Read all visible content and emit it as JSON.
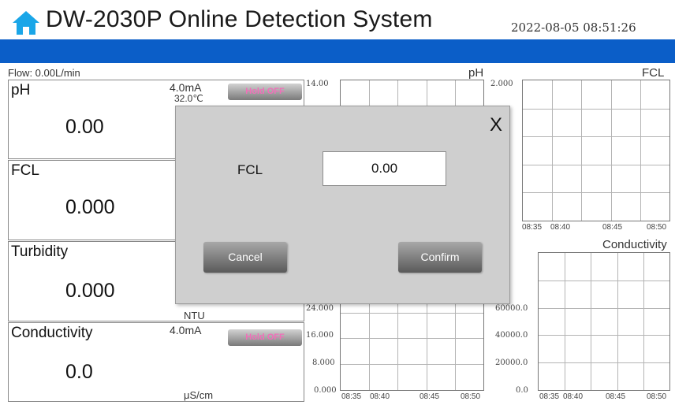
{
  "header": {
    "title": "DW-2030P Online Detection System",
    "datetime": "2022-08-05  08:51:26",
    "icon": "home-icon",
    "icon_color": "#1aa6e8"
  },
  "top_bar_color": "#0b5ec8",
  "flow": "Flow: 0.00L/min",
  "panels": [
    {
      "name": "pH",
      "value": "0.00",
      "ma": "4.0mA",
      "temp": "32.0℃",
      "hold": "Hold OFF"
    },
    {
      "name": "FCL",
      "value": "0.000"
    },
    {
      "name": "Turbidity",
      "value": "0.000",
      "unit": "NTU"
    },
    {
      "name": "Conductivity",
      "value": "0.0",
      "ma": "4.0mA",
      "unit": "μS/cm",
      "hold": "Hold OFF"
    }
  ],
  "charts": {
    "ph": {
      "title": "pH",
      "y_ticks": [
        "14.00"
      ]
    },
    "fcl": {
      "title": "FCL",
      "y_ticks": [
        "2.000"
      ],
      "x_ticks": [
        "08:35",
        "08:40",
        "08:45",
        "08:50"
      ]
    },
    "turbidity": {
      "y_ticks": [
        "24.000",
        "16.000",
        "8.000",
        "0.000"
      ],
      "x_ticks": [
        "08:35",
        "08:40",
        "08:45",
        "08:50"
      ]
    },
    "conductivity": {
      "title": "Conductivity",
      "y_ticks": [
        "60000.0",
        "40000.0",
        "20000.0",
        "0.0"
      ],
      "x_ticks": [
        "08:35",
        "08:40",
        "08:45",
        "08:50"
      ]
    }
  },
  "modal": {
    "close_label": "X",
    "field_label": "FCL",
    "field_value": "0.00",
    "cancel_label": "Cancel",
    "confirm_label": "Confirm"
  },
  "colors": {
    "hold_text": "#f06fb9",
    "modal_bg": "#cfcfcf"
  }
}
